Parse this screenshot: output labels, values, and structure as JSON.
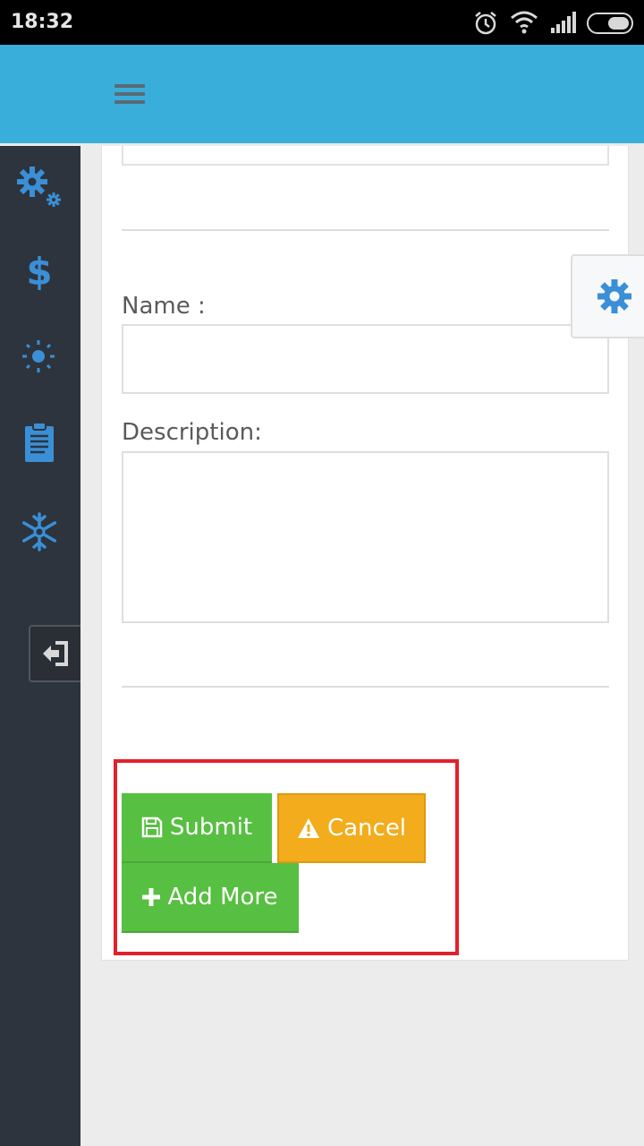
{
  "status_bar": {
    "time": "18:32",
    "icons": [
      "alarm-icon",
      "wifi-icon",
      "signal-icon",
      "battery-icon"
    ]
  },
  "header": {
    "menu_icon": "hamburger-icon",
    "bg_color": "#3aaedb"
  },
  "sidebar": {
    "items": [
      {
        "icon": "gears-icon"
      },
      {
        "icon": "dollar-icon"
      },
      {
        "icon": "sun-icon"
      },
      {
        "icon": "clipboard-icon"
      },
      {
        "icon": "snowflake-icon"
      }
    ],
    "logout_icon": "sign-out-icon",
    "accent_color": "#3a8fd6"
  },
  "form": {
    "name_label": "Name :",
    "name_value": "",
    "description_label": "Description:",
    "description_value": "",
    "buttons": {
      "submit": "Submit",
      "cancel": "Cancel",
      "add_more": "Add More"
    }
  },
  "colors": {
    "submit": "#57bf41",
    "cancel": "#f2ac1c",
    "highlight": "#e3202a"
  },
  "floating": {
    "icon": "settings-gear-icon"
  }
}
